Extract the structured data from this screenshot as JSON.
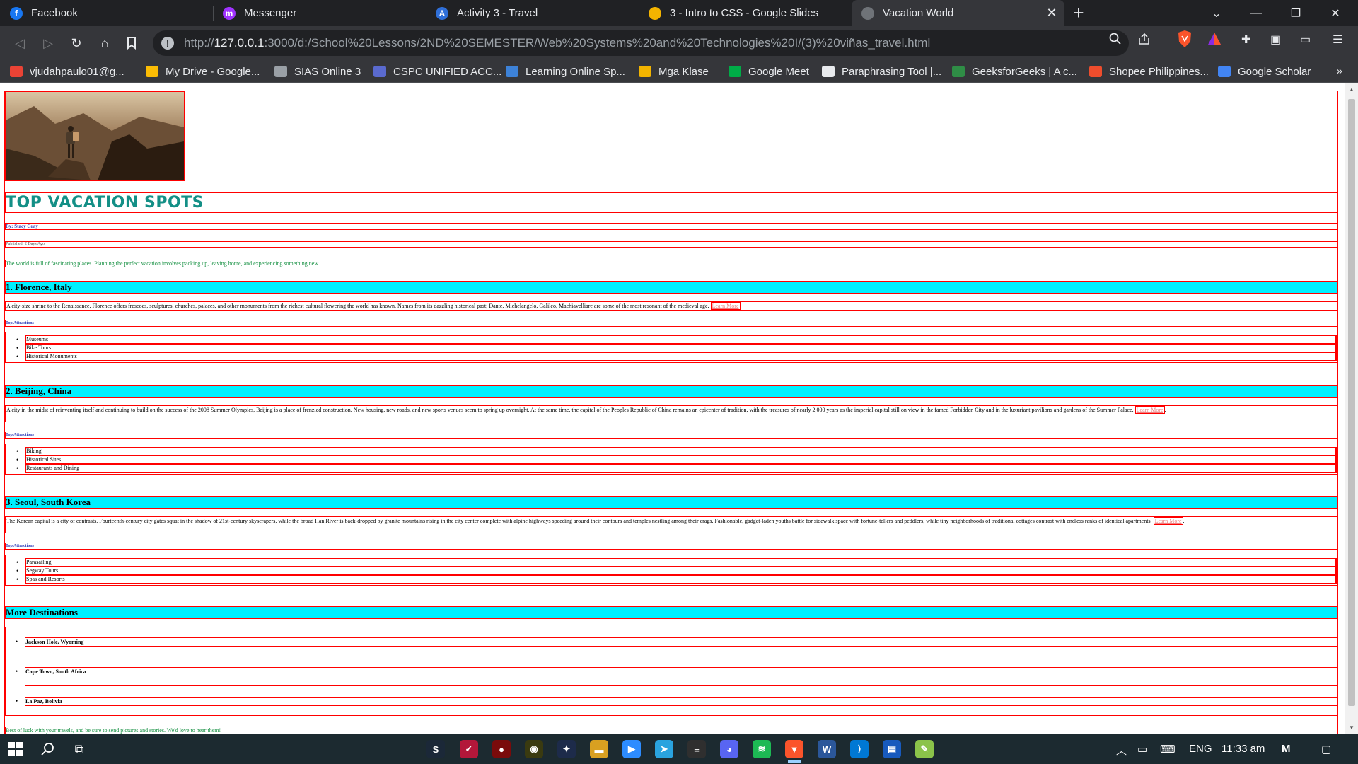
{
  "browser": {
    "tabs": [
      {
        "label": "Facebook",
        "icon": "facebook-icon",
        "color": "#1877f2",
        "glyph": "f"
      },
      {
        "label": "Messenger",
        "icon": "messenger-icon",
        "color": "#a033ff",
        "glyph": "m"
      },
      {
        "label": "Activity 3 - Travel",
        "icon": "classroom-icon",
        "color": "#2f6fd8",
        "glyph": "A"
      },
      {
        "label": "3 - Intro to CSS - Google Slides",
        "icon": "slides-icon",
        "color": "#f4b400",
        "glyph": ""
      },
      {
        "label": "Vacation World",
        "icon": "globe-icon",
        "color": "#6f7378",
        "glyph": "",
        "active": true
      }
    ],
    "new_tab_label": "+",
    "url_host": "127.0.0.1",
    "url_prefix": "http://",
    "url_rest": ":3000/d:/School%20Lessons/2ND%20SEMESTER/Web%20Systems%20and%20Technologies%20I/(3)%20viñas_travel.html",
    "bookmarks": [
      {
        "label": "vjudahpaulo01@g...",
        "icon": "gmail-icon",
        "color": "#ea4335"
      },
      {
        "label": "My Drive - Google...",
        "icon": "drive-icon",
        "color": "#fbbc04"
      },
      {
        "label": "SIAS Online 3",
        "icon": "globe-icon",
        "color": "#9aa0a6"
      },
      {
        "label": "CSPC UNIFIED ACC...",
        "icon": "cspc-icon",
        "color": "#5a6acf"
      },
      {
        "label": "Learning Online Sp...",
        "icon": "learning-icon",
        "color": "#3d82d8"
      },
      {
        "label": "Mga Klase",
        "icon": "classroom-icon",
        "color": "#f2b400"
      },
      {
        "label": "Google Meet",
        "icon": "meet-icon",
        "color": "#00ac47"
      },
      {
        "label": "Paraphrasing Tool |...",
        "icon": "quill-icon",
        "color": "#e8eaed"
      },
      {
        "label": "GeeksforGeeks | A c...",
        "icon": "gfg-icon",
        "color": "#2f8d46"
      },
      {
        "label": "Shopee Philippines...",
        "icon": "shopee-icon",
        "color": "#ee4d2d"
      },
      {
        "label": "Google Scholar",
        "icon": "scholar-icon",
        "color": "#4285f4"
      }
    ],
    "bookmarks_more": "»"
  },
  "page": {
    "title": "TOP VACATION SPOTS",
    "author": "By: Stacy Gray",
    "published": "Published: 2 Days Ago",
    "intro": "The world is full of fascinating places. Planning the perfect vacation involves packing up, leaving home, and experiencing something new.",
    "learn_more": "Learn More",
    "top_attractions_label": "Top Attractions",
    "destinations": [
      {
        "heading": "1. Florence, Italy",
        "text": "A city-size shrine to the Renaissance, Florence offers frescoes, sculptures, churches, palaces, and other monuments from the richest cultural flowering the world has known. Names from its dazzling historical past; Dante, Michelangelo, Galileo, Machiavelliare are some of the most resonant of the medieval age.",
        "attractions": [
          "Museums",
          "Bike Tours",
          "Historical Monuments"
        ]
      },
      {
        "heading": "2. Beijing, China",
        "text": "A city in the midst of reinventing itself and continuing to build on the success of the 2008 Summer Olympics, Beijing is a place of frenzied construction. New housing, new roads, and new sports venues seem to spring up overnight. At the same time, the capital of the Peoples Republic of China remains an epicenter of tradition, with the treasures of nearly 2,000 years as the imperial capital still on view in the famed Forbidden City and in the luxuriant pavilions and gardens of the Summer Palace.",
        "attractions": [
          "Biking",
          "Historical Sites",
          "Restaurants and Dining"
        ]
      },
      {
        "heading": "3. Seoul, South Korea",
        "text": "The Korean capital is a city of contrasts. Fourteenth-century city gates squat in the shadow of 21st-century skyscrapers, while the broad Han River is back-dropped by granite mountains rising in the city center complete with alpine highways speeding around their contours and temples nestling among their crags. Fashionable, gadget-laden youths battle for sidewalk space with fortune-tellers and peddlers, while tiny neighborhoods of traditional cottages contrast with endless ranks of identical apartments.",
        "attractions": [
          "Parasailing",
          "Segway Tours",
          "Spas and Resorts"
        ]
      }
    ],
    "more_heading": "More Destinations",
    "more": [
      "Jackson Hole, Wyoming",
      "Cape Town, South Africa",
      "La Paz, Bolivia"
    ],
    "footer": "Best of luck with your travels, and be sure to send pictures and stories. We'd love to hear them!"
  },
  "taskbar": {
    "language": "ENG",
    "time": "11:33 am"
  }
}
